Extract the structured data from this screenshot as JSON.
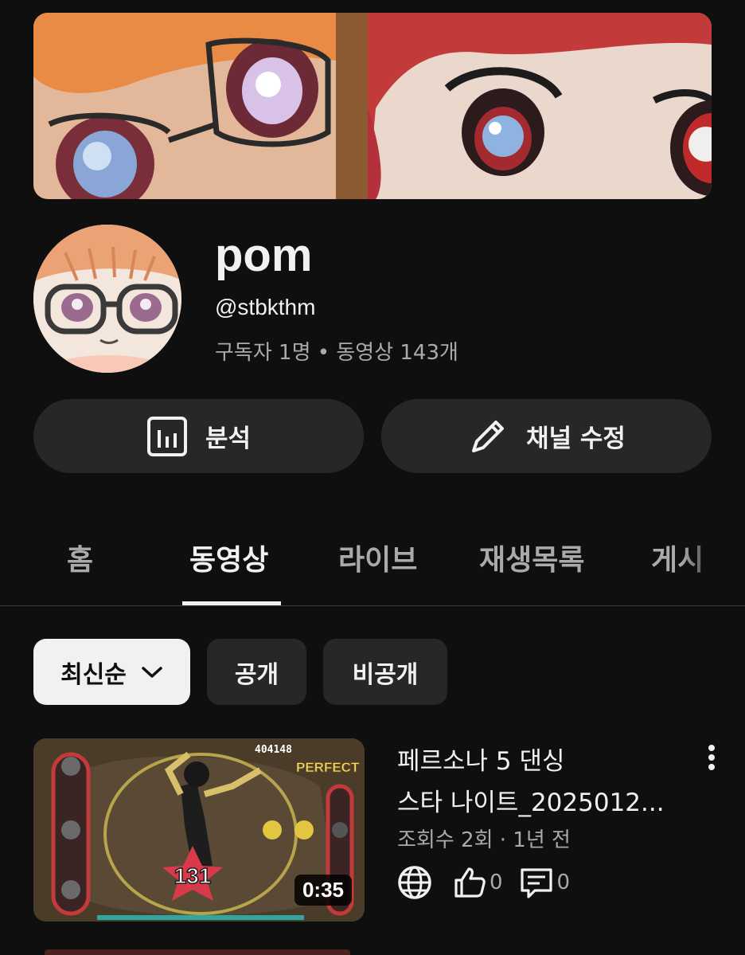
{
  "channel": {
    "name": "pom",
    "handle": "@stbkthm",
    "stats": "구독자 1명 • 동영상 143개"
  },
  "actions": {
    "analytics_label": "분석",
    "edit_label": "채널 수정"
  },
  "tabs": [
    {
      "label": "홈",
      "active": false
    },
    {
      "label": "동영상",
      "active": true
    },
    {
      "label": "라이브",
      "active": false
    },
    {
      "label": "재생목록",
      "active": false
    },
    {
      "label": "게시",
      "active": false
    }
  ],
  "filters": {
    "sort_label": "최신순",
    "public_label": "공개",
    "private_label": "비공개"
  },
  "video": {
    "title_line1": "페르소나 5 댄싱",
    "title_line2": "스타 나이트_2025012...",
    "meta": "조회수 2회 · 1년 전",
    "duration": "0:35",
    "likes": "0",
    "comments": "0",
    "thumb_score": "404148",
    "thumb_rating": "PERFECT",
    "thumb_combo": "131",
    "visibility_icon": "globe-icon"
  },
  "colors": {
    "background": "#0f0f0f",
    "button_bg": "#272727",
    "primary_text": "#f1f1f1",
    "secondary_text": "#aaaaaa"
  }
}
